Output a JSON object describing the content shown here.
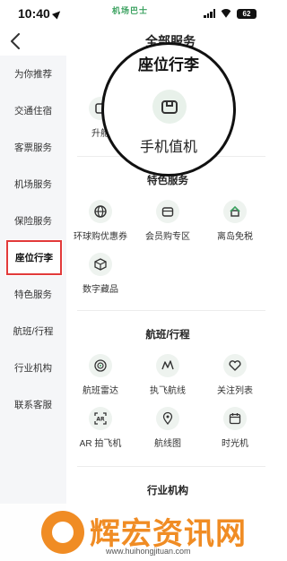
{
  "status_bar": {
    "time": "10:40",
    "app_name": "机场巴士",
    "battery": "62"
  },
  "header": {
    "title": "全部服务",
    "back_icon": "chevron-left-icon"
  },
  "sidebar": {
    "items": [
      {
        "label": "为你推荐"
      },
      {
        "label": "交通住宿"
      },
      {
        "label": "客票服务"
      },
      {
        "label": "机场服务"
      },
      {
        "label": "保险服务"
      },
      {
        "label": "座位行李",
        "active": true
      },
      {
        "label": "特色服务"
      },
      {
        "label": "航班/行程"
      },
      {
        "label": "行业机构"
      },
      {
        "label": "联系客服"
      }
    ]
  },
  "sections": {
    "seat_luggage": {
      "items": [
        {
          "label": "升舱",
          "icon": "seat-icon"
        }
      ]
    },
    "special": {
      "title": "特色服务",
      "items": [
        {
          "label": "环球购优惠券",
          "icon": "globe-icon"
        },
        {
          "label": "会员购专区",
          "icon": "bag-icon"
        },
        {
          "label": "离岛免税",
          "icon": "island-icon"
        },
        {
          "label": "数字藏品",
          "icon": "cube-icon"
        }
      ]
    },
    "flight": {
      "title": "航班/行程",
      "items": [
        {
          "label": "航班雷达",
          "icon": "radar-icon"
        },
        {
          "label": "执飞航线",
          "icon": "route-icon"
        },
        {
          "label": "关注列表",
          "icon": "heart-icon"
        },
        {
          "label": "AR 拍飞机",
          "icon": "ar-icon"
        },
        {
          "label": "航线图",
          "icon": "map-pin-icon"
        },
        {
          "label": "时光机",
          "icon": "calendar-icon"
        }
      ]
    },
    "industry": {
      "title": "行业机构"
    }
  },
  "magnifier": {
    "title": "座位行李",
    "label": "手机值机",
    "icon": "checkin-icon"
  },
  "watermark": {
    "text": "辉宏资讯网",
    "url": "www.huihongjituan.com"
  },
  "colors": {
    "accent_green": "#3aa15f",
    "highlight_red": "#e23a3a",
    "watermark_orange": "#f08c24"
  }
}
